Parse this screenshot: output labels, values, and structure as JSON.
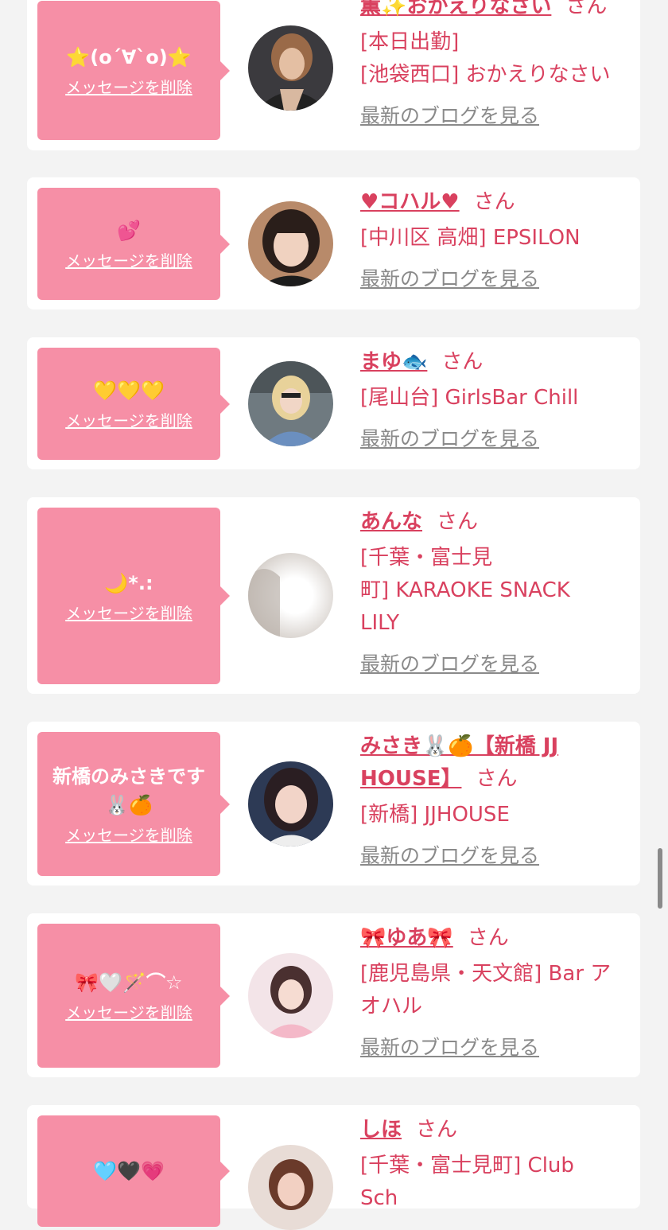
{
  "common": {
    "delete_label": "メッセージを削除",
    "san_label": "さん",
    "blog_label": "最新のブログを見る"
  },
  "cards": [
    {
      "message": "⭐(o´∀`o)⭐",
      "name": "薫✨おかえりなさい",
      "location_lines": [
        "[本日出勤]",
        "[池袋西口] おかえりなさい"
      ]
    },
    {
      "message": "💕",
      "name": "♥コハル♥",
      "location_lines": [
        "[中川区 高畑] EPSILON"
      ]
    },
    {
      "message": "💛💛💛",
      "name": "まゆ🐟",
      "location_lines": [
        "[尾山台] GirlsBar Chill"
      ]
    },
    {
      "message": "🌙*.:",
      "name": "あんな",
      "location_lines": [
        "[千葉・富士見",
        "町] KARAOKE SNACK",
        "LILY"
      ]
    },
    {
      "message": "新橋のみさきです🐰🍊",
      "name": "みさき🐰🍊【新橋 JJ HOUSE】",
      "location_lines": [
        "[新橋] JJHOUSE"
      ]
    },
    {
      "message": "🎀🤍🪄⌒☆",
      "name": "🎀ゆあ🎀",
      "location_lines": [
        "[鹿児島県・天文館] Bar ア",
        "オハル"
      ]
    },
    {
      "message": "🩵🖤💗",
      "name": "しほ",
      "location_lines": [
        "[千葉・富士見町] Club",
        "Sch"
      ]
    }
  ],
  "colors": {
    "bubble": "#f68fa6",
    "accent": "#d9415f",
    "link_gray": "#8a8a8a",
    "background": "#f3f3f3"
  }
}
